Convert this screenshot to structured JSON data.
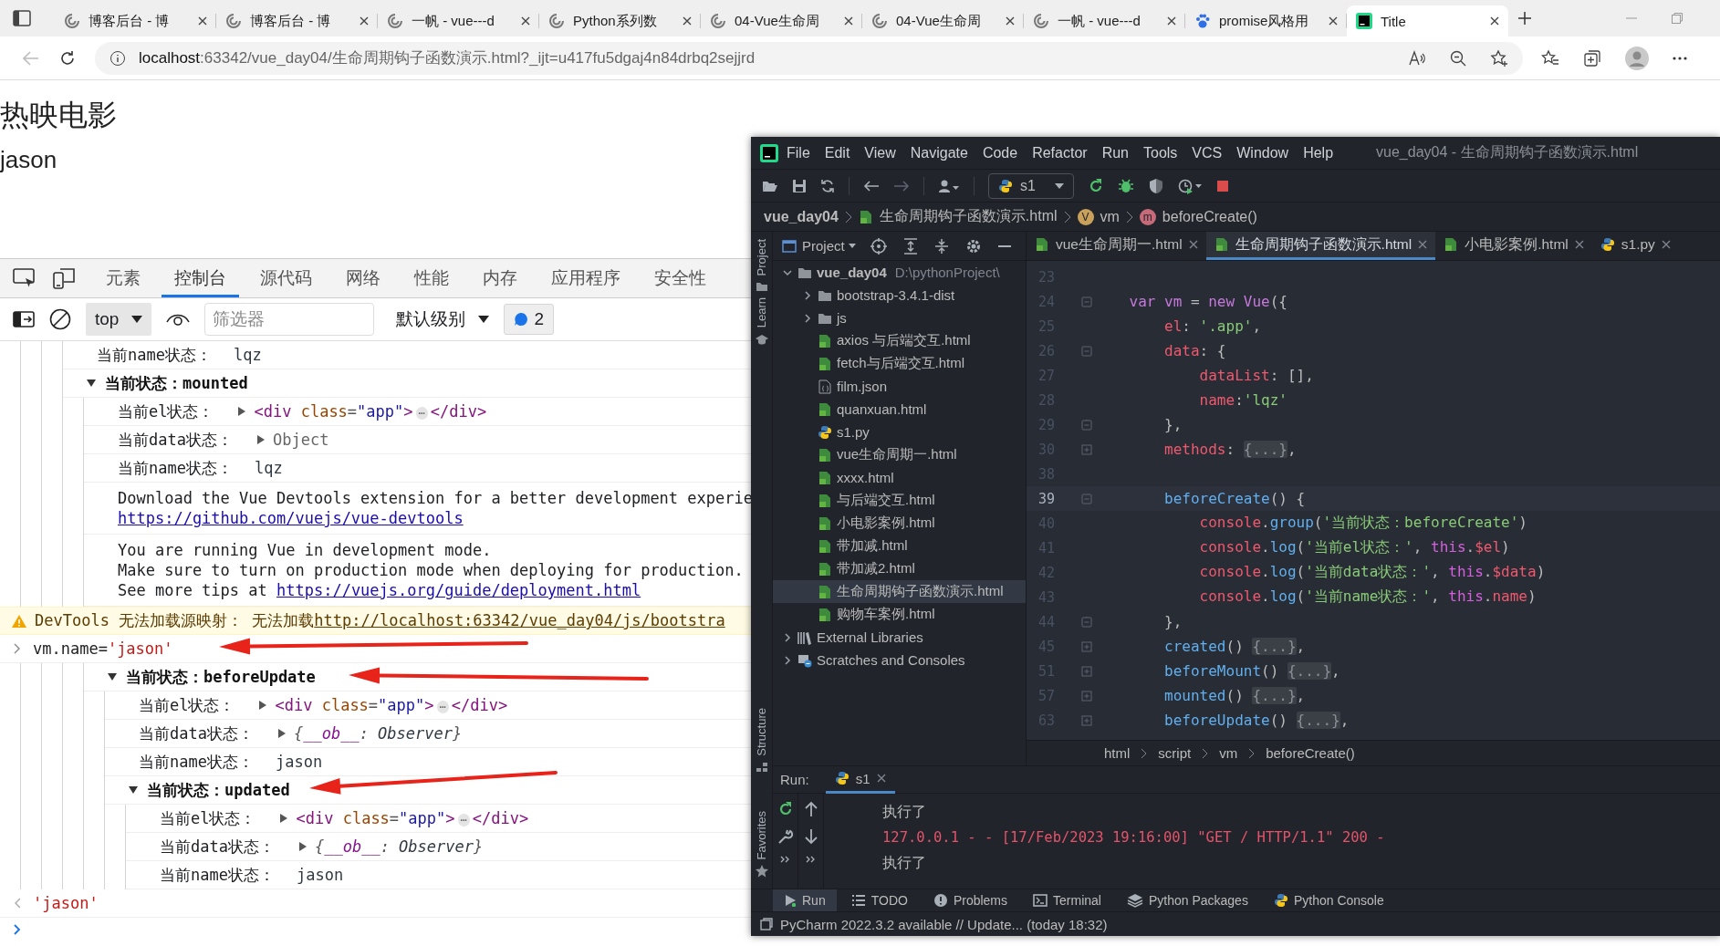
{
  "browser": {
    "tabs": [
      {
        "title": "博客后台 - 博",
        "kind": "blog",
        "selected": false
      },
      {
        "title": "博客后台 - 博",
        "kind": "blog",
        "selected": false
      },
      {
        "title": "一帆 - vue---d",
        "kind": "blog",
        "selected": false
      },
      {
        "title": "Python系列数",
        "kind": "blog",
        "selected": false
      },
      {
        "title": "04-Vue生命周",
        "kind": "blog",
        "selected": false
      },
      {
        "title": "04-Vue生命周",
        "kind": "blog",
        "selected": false
      },
      {
        "title": "一帆 - vue---d",
        "kind": "blog",
        "selected": false
      },
      {
        "title": "promise风格用",
        "kind": "search",
        "selected": false
      },
      {
        "title": "Title",
        "kind": "ide",
        "selected": true
      }
    ],
    "address": {
      "host": "localhost",
      "path": ":63342/vue_day04/生命周期钩子函数演示.html?_ijt=u417fu5dgaj4n84drbq2sejjrd"
    }
  },
  "page": {
    "heading": "热映电影",
    "name": "jason"
  },
  "devtools": {
    "tabs": [
      {
        "label": "元素",
        "selected": false
      },
      {
        "label": "控制台",
        "selected": true
      },
      {
        "label": "源代码",
        "selected": false
      },
      {
        "label": "网络",
        "selected": false
      },
      {
        "label": "性能",
        "selected": false
      },
      {
        "label": "内存",
        "selected": false
      },
      {
        "label": "应用程序",
        "selected": false
      },
      {
        "label": "安全性",
        "selected": false
      }
    ],
    "context": "top",
    "filter": {
      "placeholder": "筛选器"
    },
    "levels": "默认级别",
    "issues": "2",
    "console": [
      {
        "kind": "nest",
        "children": [
          {
            "kind": "nest",
            "children": [
              {
                "kind": "nest",
                "children": [
                  {
                    "kind": "log",
                    "label": "当前name状态：",
                    "value": {
                      "kind": "string",
                      "parts": [
                        {
                          "kind": "plain",
                          "text": "lqz"
                        }
                      ]
                    }
                  },
                  {
                    "kind": "group",
                    "title": "当前状态：mounted",
                    "expanded": true,
                    "children": [
                      {
                        "kind": "log",
                        "label": "当前el状态：",
                        "value": {
                          "kind": "node",
                          "parts": [
                            {
                              "kind": "tag",
                              "text": "<div"
                            },
                            {
                              "kind": "attr",
                              "text": " class"
                            },
                            {
                              "kind": "punct",
                              "text": "="
                            },
                            {
                              "kind": "attr-value",
                              "text": "\"app\""
                            },
                            {
                              "kind": "tag",
                              "text": ">"
                            },
                            {
                              "kind": "ellipsis",
                              "text": "⋯"
                            },
                            {
                              "kind": "tag",
                              "text": "</div>"
                            }
                          ]
                        }
                      },
                      {
                        "kind": "log",
                        "label": "当前data状态：",
                        "value": {
                          "kind": "object",
                          "parts": [
                            {
                              "kind": "plain",
                              "text": "Object"
                            }
                          ]
                        }
                      },
                      {
                        "kind": "log",
                        "label": "当前name状态：",
                        "value": {
                          "kind": "string",
                          "parts": [
                            {
                              "kind": "plain",
                              "text": "lqz"
                            }
                          ]
                        }
                      },
                      {
                        "kind": "message",
                        "lines": [
                          [
                            {
                              "kind": "text",
                              "text": "Download the Vue Devtools extension for a better development experie"
                            }
                          ],
                          [
                            {
                              "kind": "link",
                              "text": "https://github.com/vuejs/vue-devtools"
                            }
                          ]
                        ]
                      },
                      {
                        "kind": "message",
                        "lines": [
                          [
                            {
                              "kind": "text",
                              "text": "You are running Vue in development mode."
                            }
                          ],
                          [
                            {
                              "kind": "text",
                              "text": "Make sure to turn on production mode when deploying for production."
                            }
                          ],
                          [
                            {
                              "kind": "text",
                              "text": "See more tips at "
                            },
                            {
                              "kind": "link",
                              "text": "https://vuejs.org/guide/deployment.html"
                            }
                          ]
                        ]
                      }
                    ]
                  }
                ]
              }
            ]
          }
        ]
      },
      {
        "kind": "warning",
        "parts": [
          {
            "kind": "text",
            "text": "DevTools 无法加载源映射： 无法加载"
          },
          {
            "kind": "link",
            "text": "http://localhost:63342/vue_day04/js/bootstra"
          }
        ]
      },
      {
        "kind": "input",
        "parts": [
          {
            "kind": "code",
            "text": "vm.name="
          },
          {
            "kind": "string",
            "text": "'jason'"
          }
        ]
      },
      {
        "kind": "nest",
        "children": [
          {
            "kind": "nest",
            "children": [
              {
                "kind": "nest",
                "children": [
                  {
                    "kind": "nest",
                    "children": [
                      {
                        "kind": "group",
                        "title": "当前状态：beforeUpdate",
                        "expanded": true,
                        "children": [
                          {
                            "kind": "log",
                            "label": "当前el状态：",
                            "value": {
                              "kind": "node",
                              "parts": [
                                {
                                  "kind": "tag",
                                  "text": "<div"
                                },
                                {
                                  "kind": "attr",
                                  "text": " class"
                                },
                                {
                                  "kind": "punct",
                                  "text": "="
                                },
                                {
                                  "kind": "attr-value",
                                  "text": "\"app\""
                                },
                                {
                                  "kind": "tag",
                                  "text": ">"
                                },
                                {
                                  "kind": "ellipsis",
                                  "text": "⋯"
                                },
                                {
                                  "kind": "tag",
                                  "text": "</div>"
                                }
                              ]
                            }
                          },
                          {
                            "kind": "log",
                            "label": "当前data状态：",
                            "value": {
                              "kind": "preview",
                              "parts": [
                                {
                                  "kind": "punct",
                                  "text": "{"
                                },
                                {
                                  "kind": "key",
                                  "text": "__ob__"
                                },
                                {
                                  "kind": "punct",
                                  "text": ": "
                                },
                                {
                                  "kind": "plain",
                                  "text": "Observer"
                                },
                                {
                                  "kind": "punct",
                                  "text": "}"
                                }
                              ]
                            }
                          },
                          {
                            "kind": "log",
                            "label": "当前name状态：",
                            "value": {
                              "kind": "string",
                              "parts": [
                                {
                                  "kind": "plain",
                                  "text": "jason"
                                }
                              ]
                            }
                          },
                          {
                            "kind": "group",
                            "title": "当前状态：updated",
                            "expanded": true,
                            "children": [
                              {
                                "kind": "log",
                                "label": "当前el状态：",
                                "value": {
                                  "kind": "node",
                                  "parts": [
                                    {
                                      "kind": "tag",
                                      "text": "<div"
                                    },
                                    {
                                      "kind": "attr",
                                      "text": " class"
                                    },
                                    {
                                      "kind": "punct",
                                      "text": "="
                                    },
                                    {
                                      "kind": "attr-value",
                                      "text": "\"app\""
                                    },
                                    {
                                      "kind": "tag",
                                      "text": ">"
                                    },
                                    {
                                      "kind": "ellipsis",
                                      "text": "⋯"
                                    },
                                    {
                                      "kind": "tag",
                                      "text": "</div>"
                                    }
                                  ]
                                }
                              },
                              {
                                "kind": "log",
                                "label": "当前data状态：",
                                "value": {
                                  "kind": "preview",
                                  "parts": [
                                    {
                                      "kind": "punct",
                                      "text": "{"
                                    },
                                    {
                                      "kind": "key",
                                      "text": "__ob__"
                                    },
                                    {
                                      "kind": "punct",
                                      "text": ": "
                                    },
                                    {
                                      "kind": "plain",
                                      "text": "Observer"
                                    },
                                    {
                                      "kind": "punct",
                                      "text": "}"
                                    }
                                  ]
                                }
                              },
                              {
                                "kind": "log",
                                "label": "当前name状态：",
                                "value": {
                                  "kind": "string",
                                  "parts": [
                                    {
                                      "kind": "plain",
                                      "text": "jason"
                                    }
                                  ]
                                }
                              }
                            ]
                          }
                        ]
                      }
                    ]
                  }
                ]
              }
            ]
          }
        ]
      },
      {
        "kind": "result",
        "parts": [
          {
            "kind": "string",
            "text": "'jason'"
          }
        ]
      },
      {
        "kind": "prompt"
      }
    ]
  },
  "ide": {
    "menu": [
      "File",
      "Edit",
      "View",
      "Navigate",
      "Code",
      "Refactor",
      "Run",
      "Tools",
      "VCS",
      "Window",
      "Help"
    ],
    "title": "vue_day04 - 生命周期钩子函数演示.html",
    "run_config": "s1",
    "nav": [
      {
        "kind": "project",
        "text": "vue_day04"
      },
      {
        "kind": "html",
        "text": "生命周期钩子函数演示.html"
      },
      {
        "kind": "variable",
        "badge": "V",
        "text": "vm"
      },
      {
        "kind": "method",
        "badge": "m",
        "text": "beforeCreate()"
      }
    ],
    "side_top": [
      "Project",
      "Learn"
    ],
    "side_middle": "Structure",
    "side_bottom": "Favorites",
    "project": {
      "title": "Project",
      "tree": [
        {
          "name": "vue_day04",
          "hint": "D:\\pythonProject\\",
          "kind": "folder",
          "expanded": true,
          "selected": false,
          "children": [
            {
              "name": "bootstrap-3.4.1-dist",
              "kind": "folder",
              "expanded": false,
              "selected": false
            },
            {
              "name": "js",
              "kind": "folder",
              "expanded": false,
              "selected": false
            },
            {
              "name": "axios 与后端交互.html",
              "kind": "html",
              "selected": false
            },
            {
              "name": "fetch与后端交互.html",
              "kind": "html",
              "selected": false
            },
            {
              "name": "film.json",
              "kind": "json",
              "selected": false
            },
            {
              "name": "quanxuan.html",
              "kind": "html",
              "selected": false
            },
            {
              "name": "s1.py",
              "kind": "py",
              "selected": false
            },
            {
              "name": "vue生命周期一.html",
              "kind": "html",
              "selected": false
            },
            {
              "name": "xxxx.html",
              "kind": "html",
              "selected": false
            },
            {
              "name": "与后端交互.html",
              "kind": "html",
              "selected": false
            },
            {
              "name": "小电影案例.html",
              "kind": "html",
              "selected": false
            },
            {
              "name": "带加减.html",
              "kind": "html",
              "selected": false
            },
            {
              "name": "带加减2.html",
              "kind": "html",
              "selected": false
            },
            {
              "name": "生命周期钩子函数演示.html",
              "kind": "html",
              "selected": true
            },
            {
              "name": "购物车案例.html",
              "kind": "html",
              "selected": false
            }
          ]
        },
        {
          "name": "External Libraries",
          "kind": "library",
          "expanded": false,
          "selected": false
        },
        {
          "name": "Scratches and Consoles",
          "kind": "scratch",
          "expanded": false,
          "selected": false
        }
      ]
    },
    "editor": {
      "tabs": [
        {
          "name": "vue生命周期一.html",
          "kind": "html",
          "selected": false
        },
        {
          "name": "生命周期钩子函数演示.html",
          "kind": "html",
          "selected": true
        },
        {
          "name": "小电影案例.html",
          "kind": "html",
          "selected": false
        },
        {
          "name": "s1.py",
          "kind": "py",
          "selected": false
        }
      ],
      "lines": [
        {
          "number": "23",
          "current": false,
          "kind": "plain"
        },
        {
          "number": "24",
          "current": false,
          "kind": "fold-start",
          "tokens": [
            {
              "kind": "kw",
              "text": "var "
            },
            {
              "kind": "kw",
              "text": "vm"
            },
            {
              "kind": "plain",
              "text": " = "
            },
            {
              "kind": "kw",
              "text": "new "
            },
            {
              "kind": "kw",
              "text": "Vue"
            },
            {
              "kind": "plain",
              "text": "({"
            }
          ]
        },
        {
          "number": "25",
          "current": false,
          "kind": "plain",
          "tokens": [
            {
              "kind": "prop",
              "text": "el"
            },
            {
              "kind": "plain",
              "text": ": "
            },
            {
              "kind": "str",
              "text": "'.app'"
            },
            {
              "kind": "plain",
              "text": ","
            }
          ]
        },
        {
          "number": "26",
          "current": false,
          "kind": "fold-start",
          "tokens": [
            {
              "kind": "prop",
              "text": "data"
            },
            {
              "kind": "plain",
              "text": ": {"
            }
          ]
        },
        {
          "number": "27",
          "current": false,
          "kind": "plain",
          "tokens": [
            {
              "kind": "prop",
              "text": "dataList"
            },
            {
              "kind": "plain",
              "text": ": [],"
            }
          ]
        },
        {
          "number": "28",
          "current": false,
          "kind": "plain",
          "tokens": [
            {
              "kind": "prop",
              "text": "name"
            },
            {
              "kind": "plain",
              "text": ":"
            },
            {
              "kind": "str",
              "text": "'lqz'"
            }
          ]
        },
        {
          "number": "29",
          "current": false,
          "kind": "fold-end",
          "tokens": [
            {
              "kind": "plain",
              "text": "},"
            }
          ]
        },
        {
          "number": "30",
          "current": false,
          "kind": "folded",
          "tokens": [
            {
              "kind": "prop",
              "text": "methods"
            },
            {
              "kind": "plain",
              "text": ": "
            },
            {
              "kind": "folded",
              "text": "{...}"
            },
            {
              "kind": "plain",
              "text": ","
            }
          ]
        },
        {
          "number": "38",
          "current": false,
          "kind": "plain"
        },
        {
          "number": "39",
          "current": true,
          "kind": "fold-start",
          "tokens": [
            {
              "kind": "fn",
              "text": "beforeCreate"
            },
            {
              "kind": "plain",
              "text": "() {"
            }
          ]
        },
        {
          "number": "40",
          "current": false,
          "kind": "plain",
          "tokens": [
            {
              "kind": "prop",
              "text": "console"
            },
            {
              "kind": "plain",
              "text": "."
            },
            {
              "kind": "fn",
              "text": "group"
            },
            {
              "kind": "plain",
              "text": "("
            },
            {
              "kind": "str",
              "text": "'当前状态：beforeCreate'"
            },
            {
              "kind": "plain",
              "text": ")"
            }
          ]
        },
        {
          "number": "41",
          "current": false,
          "kind": "plain",
          "tokens": [
            {
              "kind": "prop",
              "text": "console"
            },
            {
              "kind": "plain",
              "text": "."
            },
            {
              "kind": "fn",
              "text": "log"
            },
            {
              "kind": "plain",
              "text": "("
            },
            {
              "kind": "str",
              "text": "'当前el状态：'"
            },
            {
              "kind": "plain",
              "text": ", "
            },
            {
              "kind": "this",
              "text": "this"
            },
            {
              "kind": "plain",
              "text": "."
            },
            {
              "kind": "prop",
              "text": "$el"
            },
            {
              "kind": "plain",
              "text": ")"
            }
          ]
        },
        {
          "number": "42",
          "current": false,
          "kind": "plain",
          "tokens": [
            {
              "kind": "prop",
              "text": "console"
            },
            {
              "kind": "plain",
              "text": "."
            },
            {
              "kind": "fn",
              "text": "log"
            },
            {
              "kind": "plain",
              "text": "("
            },
            {
              "kind": "str",
              "text": "'当前data状态：'"
            },
            {
              "kind": "plain",
              "text": ", "
            },
            {
              "kind": "this",
              "text": "this"
            },
            {
              "kind": "plain",
              "text": "."
            },
            {
              "kind": "prop",
              "text": "$data"
            },
            {
              "kind": "plain",
              "text": ")"
            }
          ]
        },
        {
          "number": "43",
          "current": false,
          "kind": "plain",
          "tokens": [
            {
              "kind": "prop",
              "text": "console"
            },
            {
              "kind": "plain",
              "text": "."
            },
            {
              "kind": "fn",
              "text": "log"
            },
            {
              "kind": "plain",
              "text": "("
            },
            {
              "kind": "str",
              "text": "'当前name状态：'"
            },
            {
              "kind": "plain",
              "text": ", "
            },
            {
              "kind": "this",
              "text": "this"
            },
            {
              "kind": "plain",
              "text": "."
            },
            {
              "kind": "prop",
              "text": "name"
            },
            {
              "kind": "plain",
              "text": ")"
            }
          ]
        },
        {
          "number": "44",
          "current": false,
          "kind": "fold-end",
          "tokens": [
            {
              "kind": "plain",
              "text": "},"
            }
          ]
        },
        {
          "number": "45",
          "current": false,
          "kind": "folded",
          "tokens": [
            {
              "kind": "fn",
              "text": "created"
            },
            {
              "kind": "plain",
              "text": "() "
            },
            {
              "kind": "folded",
              "text": "{...}"
            },
            {
              "kind": "plain",
              "text": ","
            }
          ]
        },
        {
          "number": "51",
          "current": false,
          "kind": "folded",
          "tokens": [
            {
              "kind": "fn",
              "text": "beforeMount"
            },
            {
              "kind": "plain",
              "text": "() "
            },
            {
              "kind": "folded",
              "text": "{...}"
            },
            {
              "kind": "plain",
              "text": ","
            }
          ]
        },
        {
          "number": "57",
          "current": false,
          "kind": "folded",
          "tokens": [
            {
              "kind": "fn",
              "text": "mounted"
            },
            {
              "kind": "plain",
              "text": "() "
            },
            {
              "kind": "folded",
              "text": "{...}"
            },
            {
              "kind": "plain",
              "text": ","
            }
          ]
        },
        {
          "number": "63",
          "current": false,
          "kind": "folded",
          "tokens": [
            {
              "kind": "fn",
              "text": "beforeUpdate"
            },
            {
              "kind": "plain",
              "text": "() "
            },
            {
              "kind": "folded",
              "text": "{...}"
            },
            {
              "kind": "plain",
              "text": ","
            }
          ]
        }
      ],
      "breadcrumb": [
        "html",
        "script",
        "vm",
        "beforeCreate()"
      ]
    },
    "run": {
      "label": "Run:",
      "tab": "s1",
      "output": [
        {
          "kind": "normal",
          "text": "执行了"
        },
        {
          "kind": "error",
          "text": "127.0.0.1 - - [17/Feb/2023 19:16:00] \"GET / HTTP/1.1\" 200 -"
        },
        {
          "kind": "normal",
          "text": "执行了"
        }
      ]
    },
    "tool_tabs": [
      {
        "label": "Run",
        "kind": "run",
        "selected": true
      },
      {
        "label": "TODO",
        "kind": "todo",
        "selected": false
      },
      {
        "label": "Problems",
        "kind": "problems",
        "selected": false
      },
      {
        "label": "Terminal",
        "kind": "terminal",
        "selected": false
      },
      {
        "label": "Python Packages",
        "kind": "packages",
        "selected": false
      },
      {
        "label": "Python Console",
        "kind": "console",
        "selected": false
      }
    ],
    "status": "PyCharm 2022.3.2 available // Update... (today 18:32)"
  }
}
